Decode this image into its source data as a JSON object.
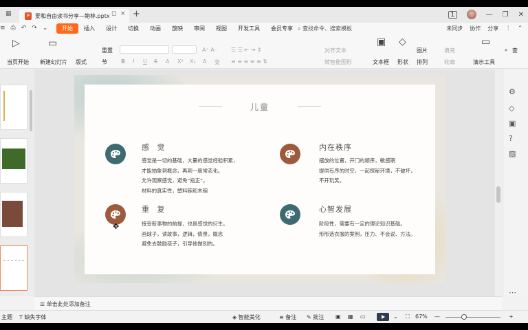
{
  "tabbar": {
    "doc_icon": "P",
    "doc_name": "爱和自由读书分享—鲍林.pptx",
    "pin_glyph": "◻",
    "close_glyph": "×",
    "new_tab": "+",
    "badge": "1",
    "minimize": "—",
    "restore": "❐",
    "close": "✕"
  },
  "menubar": {
    "left_icons": [
      "≡",
      "⎙",
      "↶",
      "↷",
      "⌄"
    ],
    "items": [
      "开始",
      "插入",
      "设计",
      "切换",
      "动画",
      "放映",
      "审阅",
      "视图",
      "开发工具",
      "会员专享"
    ],
    "active_index": 0,
    "search_placeholder": "查找命令、搜索模板",
    "right": [
      "未同步",
      "协作",
      "分享",
      "⋮",
      "⌃"
    ]
  },
  "ribbon": {
    "play_from": "当页开始",
    "new_slide": "新建幻灯片",
    "layout": "版式",
    "section": "节",
    "reset": "重置",
    "font_buttons": [
      "B",
      "I",
      "U",
      "S",
      "A",
      "X²",
      "X₂",
      "A",
      "变"
    ],
    "text_box": "文本框",
    "shape": "形状",
    "arrange": "排列",
    "picture": "图片",
    "fill": "填充",
    "outline": "轮廓",
    "align_text": "对齐文本",
    "smart_shape": "转智能图形",
    "presenter": "演示工具",
    "find": "查找",
    "find_short": "查"
  },
  "slide": {
    "title": "儿童",
    "sections": [
      {
        "title": "感 觉",
        "lines": [
          "感觉是一切的基础，大量的感觉经验积累，",
          "才能抽象到概念，再到一般常态化。",
          "允许观察感觉，避免“指正”。",
          "材料的真实性，塑料碗和木碗"
        ]
      },
      {
        "title": "内在秩序",
        "lines": [
          "摆放的位置，开门的顺序，敏感期",
          "提供有序的时空，一起探秘环境，不破坏，",
          "不开玩笑。"
        ]
      },
      {
        "title": "重 复",
        "lines": [
          "接受新事物的前提，也是感觉的衍生。",
          "画球子，读故事，逻辑，倩景，概念",
          "避免去鼓励孩子，引导他做别的。"
        ]
      },
      {
        "title": "心智发展",
        "lines": [
          "阶段性，需要有一定的理论知识基础。",
          "形形选衣服的案例，压力、不会说、方法。"
        ]
      }
    ]
  },
  "notes": {
    "placeholder": "单击此处添加备注"
  },
  "status": {
    "theme": "主题",
    "missing_font": "缺失字体",
    "smart_beautify": "智能美化",
    "notes": "备注",
    "comments": "批注",
    "zoom": "67%",
    "zoom_minus": "—",
    "zoom_plus": "+"
  },
  "colors": {
    "accent": "#ff6a1a",
    "teal_icon": "#3e6b72",
    "brown_icon": "#9b5b3c"
  }
}
